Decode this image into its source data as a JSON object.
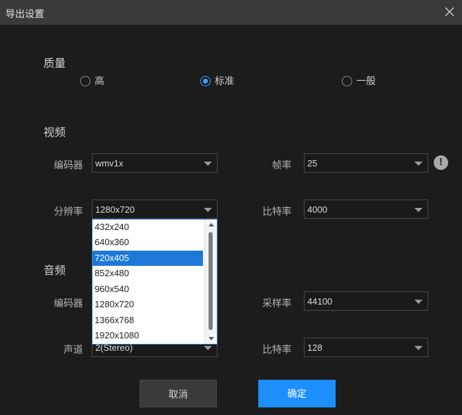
{
  "window": {
    "title": "导出设置"
  },
  "quality": {
    "heading": "质量",
    "options": [
      {
        "label": "高",
        "checked": false
      },
      {
        "label": "标准",
        "checked": true
      },
      {
        "label": "一般",
        "checked": false
      }
    ]
  },
  "video": {
    "heading": "视频",
    "encoder_label": "编码器",
    "encoder_value": "wmv1x",
    "framerate_label": "帧率",
    "framerate_value": "25",
    "resolution_label": "分辨率",
    "resolution_value": "1280x720",
    "bitrate_label": "比特率",
    "bitrate_value": "4000",
    "warning_glyph": "!"
  },
  "resolution_dropdown": {
    "options": [
      "432x240",
      "640x360",
      "720x405",
      "852x480",
      "960x540",
      "1280x720",
      "1366x768",
      "1920x1080"
    ],
    "highlighted": "720x405"
  },
  "audio": {
    "heading": "音频",
    "encoder_label": "编码器",
    "samplerate_label": "采样率",
    "samplerate_value": "44100",
    "channel_label": "声道",
    "channel_value": "2(Stereo)",
    "bitrate_label": "比特率",
    "bitrate_value": "128"
  },
  "buttons": {
    "cancel": "取消",
    "ok": "确定"
  },
  "colors": {
    "accent": "#1e8fff",
    "radio_checked": "#3fa0ff",
    "dropdown_highlight": "#1e78d7"
  }
}
